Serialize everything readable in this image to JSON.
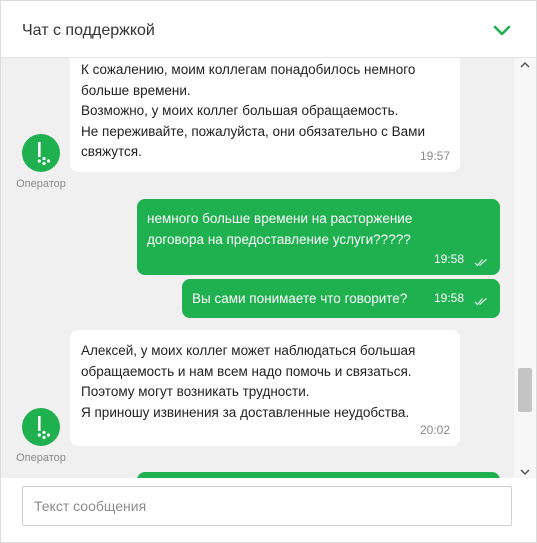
{
  "header": {
    "title": "Чат с поддержкой"
  },
  "messages": [
    {
      "sender": "operator",
      "text": "К сожалению, моим коллегам понадобилось немного\nбольше времени.\nВозможно, у моих коллег большая обращаемость.\nНе переживайте, пожалуйста, они обязательно с Вами\nсвяжутся.",
      "time": "19:57"
    },
    {
      "sender": "user",
      "text": "немного больше времени на расторжение\nдоговора на предоставление услуги?????",
      "time": "19:58"
    },
    {
      "sender": "user",
      "text": "Вы сами понимаете что говорите?",
      "time": "19:58"
    },
    {
      "sender": "operator",
      "text": "Алексей, у моих коллег может наблюдаться большая\nобращаемость и нам всем надо помочь и связаться.\nПоэтому могут возникать трудности.\nЯ приношу извинения за доставленные неудобства.",
      "time": "20:02"
    }
  ],
  "operator_label": "Оператор",
  "composer": {
    "placeholder": "Текст сообщения"
  },
  "colors": {
    "brand": "#1fb050",
    "chat_background": "#f0f0f0"
  }
}
